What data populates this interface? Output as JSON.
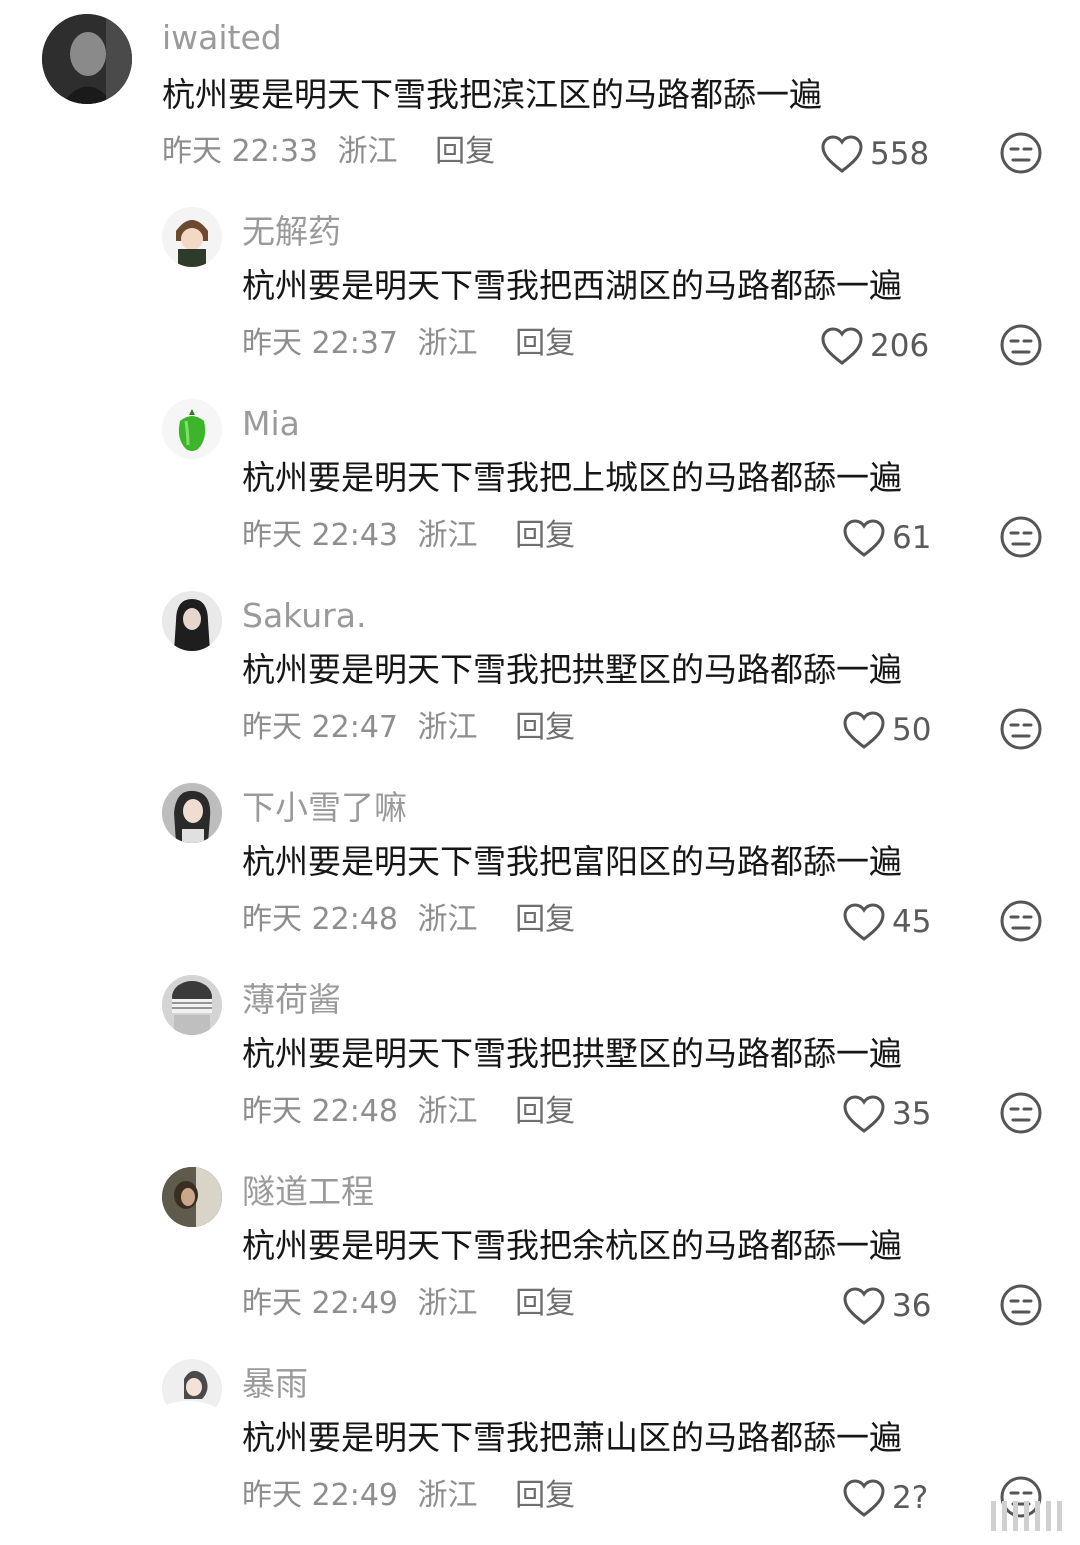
{
  "comments": [
    {
      "username": "iwaited",
      "text": "杭州要是明天下雪我把滨江区的马路都舔一遍",
      "time": "昨天 22:33",
      "location": "浙江",
      "reply_label": "回复",
      "likes": "558",
      "avatar_icon": "avatar-dark-photo"
    },
    {
      "username": "无解药",
      "text": "杭州要是明天下雪我把西湖区的马路都舔一遍",
      "time": "昨天 22:37",
      "location": "浙江",
      "reply_label": "回复",
      "likes": "206",
      "avatar_icon": "avatar-cartoon-figure"
    },
    {
      "username": "Mia",
      "text": "杭州要是明天下雪我把上城区的马路都舔一遍",
      "time": "昨天 22:43",
      "location": "浙江",
      "reply_label": "回复",
      "likes": "61",
      "avatar_icon": "avatar-green-pepper"
    },
    {
      "username": "Sakura.",
      "text": "杭州要是明天下雪我把拱墅区的马路都舔一遍",
      "time": "昨天 22:47",
      "location": "浙江",
      "reply_label": "回复",
      "likes": "50",
      "avatar_icon": "avatar-portrait-bw"
    },
    {
      "username": "下小雪了嘛",
      "text": "杭州要是明天下雪我把富阳区的马路都舔一遍",
      "time": "昨天 22:48",
      "location": "浙江",
      "reply_label": "回复",
      "likes": "45",
      "avatar_icon": "avatar-portrait"
    },
    {
      "username": "薄荷酱",
      "text": "杭州要是明天下雪我把拱墅区的马路都舔一遍",
      "time": "昨天 22:48",
      "location": "浙江",
      "reply_label": "回复",
      "likes": "35",
      "avatar_icon": "avatar-portrait-bw"
    },
    {
      "username": "隧道工程",
      "text": "杭州要是明天下雪我把余杭区的马路都舔一遍",
      "time": "昨天 22:49",
      "location": "浙江",
      "reply_label": "回复",
      "likes": "36",
      "avatar_icon": "avatar-photo"
    },
    {
      "username": "暴雨",
      "text": "杭州要是明天下雪我把萧山区的马路都舔一遍",
      "time": "昨天 22:49",
      "location": "浙江",
      "reply_label": "回复",
      "likes": "2?",
      "avatar_icon": "avatar-portrait-light"
    }
  ],
  "colors": {
    "username": "#9a9a9a",
    "text": "#161616",
    "meta": "#8e8e8e",
    "icon": "#555555"
  },
  "icons": {
    "like": "heart-outline-icon",
    "dislike": "unamused-face-icon"
  }
}
